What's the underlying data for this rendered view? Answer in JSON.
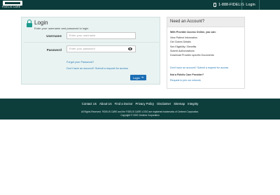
{
  "header": {
    "logo_text": "FIDELIS CARE",
    "phone": "1-888-FIDELIS",
    "login_label": "Login"
  },
  "login": {
    "title": "Login",
    "subtitle": "Enter your username and password to login",
    "username_label": "Username",
    "username_placeholder": "Enter your username",
    "password_label": "Password",
    "password_placeholder": "Enter your password",
    "forgot_link": "Forgot your Password?",
    "no_account_link": "Don't have an account? Submit a request for access",
    "submit_label": "Login"
  },
  "account": {
    "title": "Need an Account?",
    "intro": "With Provider Access Online, you can:",
    "items": [
      "View Patient Information",
      "Get Claims Details",
      "See Eligibility / Benefits",
      "Submit Authorizations",
      "Download Provider-specific Documents"
    ],
    "request_link": "Don't have an account? Submit a request for access",
    "not_provider": "Not a Fidelis Care Provider?",
    "network_link": "Request to join our network"
  },
  "footer": {
    "links": [
      "Contact Us",
      "About Us",
      "Find a Doctor",
      "Privacy Policy",
      "Disclaimer",
      "Sitemap",
      "Integrity"
    ],
    "rights": "All Rights Reserved. FIDELIS CARE and the FIDELIS CARE LOGO are registered trademarks of Centene Corporation.",
    "copyright": "Copyright © 2022 Centene Corporation"
  },
  "colors": {
    "header_bg": "#0b3b3a",
    "panel_bg": "#e9f3f2",
    "accent": "#1c9a8e",
    "button": "#1c6fb5",
    "link": "#2a7bb5"
  }
}
